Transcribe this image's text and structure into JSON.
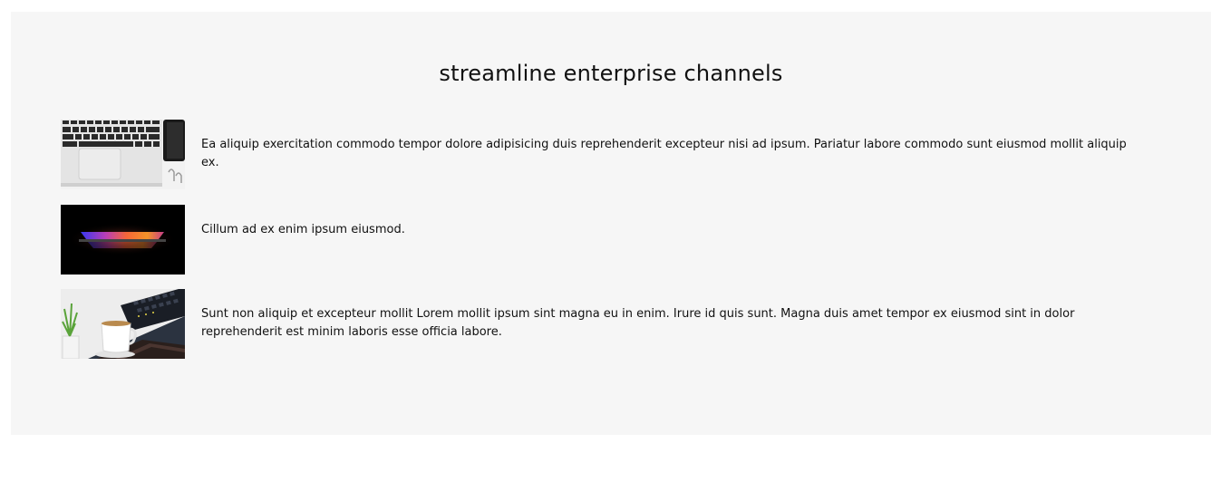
{
  "section": {
    "title": "streamline enterprise channels"
  },
  "items": [
    {
      "thumbnail_icon": "laptop-keyboard-thumbnail",
      "text": "Ea aliquip exercitation commodo tempor dolore adipisicing duis reprehenderit excepteur nisi ad ipsum. Pariatur labore commodo sunt eiusmod mollit aliquip ex."
    },
    {
      "thumbnail_icon": "glowing-laptop-thumbnail",
      "text": "Cillum ad ex enim ipsum eiusmod."
    },
    {
      "thumbnail_icon": "desk-coffee-keyboard-thumbnail",
      "text": "Sunt non aliquip et excepteur mollit Lorem mollit ipsum sint magna eu in enim. Irure id quis sunt. Magna duis amet tempor ex eiusmod sint in dolor reprehenderit est minim laboris esse officia labore."
    }
  ],
  "colors": {
    "panel_background": "#f6f6f6",
    "text": "#111111"
  }
}
